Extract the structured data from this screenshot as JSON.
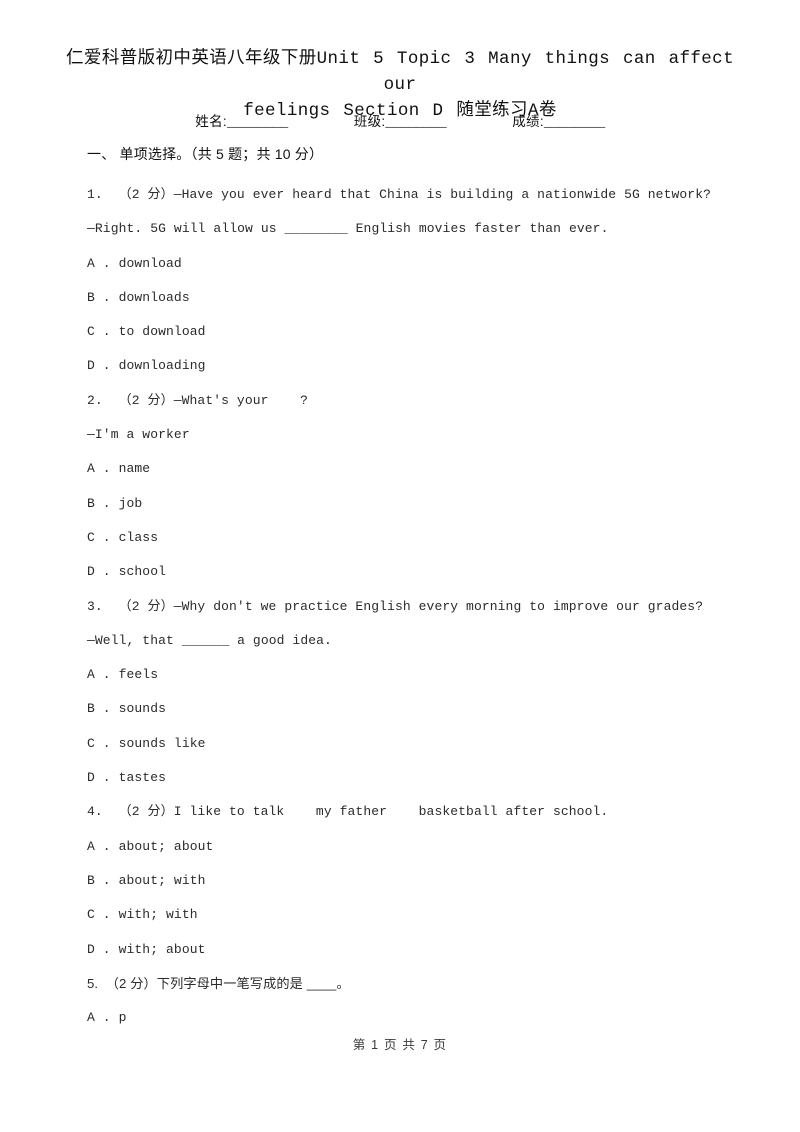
{
  "document": {
    "title": "仁爱科普版初中英语八年级下册Unit 5 Topic 3 Many things can affect our feelings Section D 随堂练习A卷",
    "title_line1": "仁爱科普版初中英语八年级下册Unit 5 Topic 3 Many things can affect our",
    "title_line2": "feelings Section D 随堂练习A卷"
  },
  "info": {
    "name_label": "姓名:",
    "name_blank": "________",
    "class_label": "班级:",
    "class_blank": "________",
    "score_label": "成绩:",
    "score_blank": "________"
  },
  "section": {
    "heading": "一、 单项选择。（共 5 题；共 10 分）"
  },
  "questions": [
    {
      "number": "1.",
      "points": "（2 分）",
      "stem_lines": [
        "1.  （2 分）—Have you ever heard that China is building a nationwide 5G network?",
        "—Right. 5G will allow us ________ English movies faster than ever."
      ],
      "options": [
        "A . download",
        "B . downloads",
        "C . to download",
        "D . downloading"
      ]
    },
    {
      "number": "2.",
      "points": "（2 分）",
      "stem_lines": [
        "2.  （2 分）—What's your    ?",
        "—I'm a worker"
      ],
      "options": [
        "A . name",
        "B . job",
        "C . class",
        "D . school"
      ]
    },
    {
      "number": "3.",
      "points": "（2 分）",
      "stem_lines": [
        "3.  （2 分）—Why don't we practice English every morning to improve our grades?",
        "—Well, that ______ a good idea."
      ],
      "options": [
        "A . feels",
        "B . sounds",
        "C . sounds like",
        "D . tastes"
      ]
    },
    {
      "number": "4.",
      "points": "（2 分）",
      "stem_lines": [
        "4.  （2 分）I like to talk    my father    basketball after school."
      ],
      "options": [
        "A . about; about",
        "B . about; with",
        "C . with; with",
        "D . with; about"
      ]
    },
    {
      "number": "5.",
      "points": "（2 分）",
      "stem_lines": [
        "5.  （2 分）下列字母中一笔写成的是 ____。"
      ],
      "options": [
        "A . p"
      ]
    }
  ],
  "footer": {
    "text": "第 1 页 共 7 页",
    "current_page": "1",
    "total_pages": "7"
  }
}
